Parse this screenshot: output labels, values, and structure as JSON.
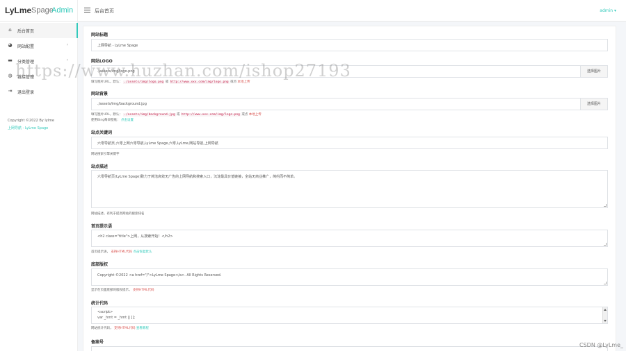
{
  "brand": {
    "part1": "LyLme",
    "part2": "Spage",
    "part3": "Admin"
  },
  "header": {
    "title": "后台首页",
    "user": "admin ▾"
  },
  "sidebar": {
    "items": [
      {
        "label": "后台首页",
        "icon": "home-icon",
        "glyph": "⌂",
        "active": true,
        "arrow": ""
      },
      {
        "label": "网站配置",
        "icon": "palette-icon",
        "glyph": "◕",
        "active": false,
        "arrow": "›"
      },
      {
        "label": "分类管理",
        "icon": "folder-icon",
        "glyph": "▬",
        "active": false,
        "arrow": "›"
      },
      {
        "label": "链接管理",
        "icon": "globe-icon",
        "glyph": "◍",
        "active": false,
        "arrow": ""
      },
      {
        "label": "退出登录",
        "icon": "logout-icon",
        "glyph": "⇥",
        "active": false,
        "arrow": ""
      }
    ],
    "copyright_line": "Copyright ©2022 By lylme",
    "copyright_link": "上网导航 - LyLme Spage"
  },
  "form": {
    "site_title": {
      "label": "网站标题",
      "value": "上网导航 - LyLme Spage"
    },
    "site_logo": {
      "label": "网站LOGO",
      "value": "./assets/img/logo.png",
      "button": "选择图片",
      "help_pre": "填写图片URL，默认：",
      "help_code1": "./assets/img/logo.png",
      "help_mid": "或",
      "help_code2": "http://www.xxx.com/img/logo.png",
      "help_post": "或点",
      "help_link": "本地上传"
    },
    "site_bg": {
      "label": "网站背景",
      "value": "./assets/img/background.jpg",
      "button": "选择图片",
      "help_pre": "填写图片URL，默认：",
      "help_code1": "./assets/img/background.jpg",
      "help_mid": "或",
      "help_code2": "http://www.xxx.com/img/logo.png",
      "help_post": "或点",
      "help_link": "本地上传",
      "help2_pre": "使用Bing每日壁纸：",
      "help2_link": "点击设置"
    },
    "keywords": {
      "label": "站点关键词",
      "value": "六零导航页,六零上网六零导航,LyLme Spage,六零,LyLme,网站导航,上网导航",
      "help": "网站搜索引擎关键字"
    },
    "description": {
      "label": "站点描述",
      "value": "六零导航页(LyLme Spage)致力于简洁高效无广告的上网导航和搜索入口，沉淀最具价值链接，全站无商业推广，简约而不简单。",
      "help": "网站描述，有利于提高网站的搜索排名"
    },
    "home_tip": {
      "label": "首页提示语",
      "value": "<h2 class=\"title\">上网，从搜索开始！</h2>",
      "help_pre": "首页提示语，",
      "help_red": "支持HTML代码",
      "help_link": "点击恢复默认"
    },
    "footer": {
      "label": "底部版权",
      "value": "Copyright ©2022 <a href=\"/\">LyLme Spage</a>.  All Rights Reserved.",
      "help_pre": "显示在页面底部的版权提示，",
      "help_red": "支持HTML代码"
    },
    "stats": {
      "label": "统计代码",
      "line1": "<script>",
      "line2": "var _hmt = _hmt || [];",
      "help_pre": "网站统计代码，",
      "help_red": "支持HTML代码",
      "help_link": "查看教程"
    },
    "icp": {
      "label": "备案号"
    }
  },
  "watermark": "https://www.huzhan.com/ishop27193",
  "credit": "CSDN @LyLme_",
  "colors": {
    "accent": "#33cabb",
    "danger": "#d9534f"
  }
}
